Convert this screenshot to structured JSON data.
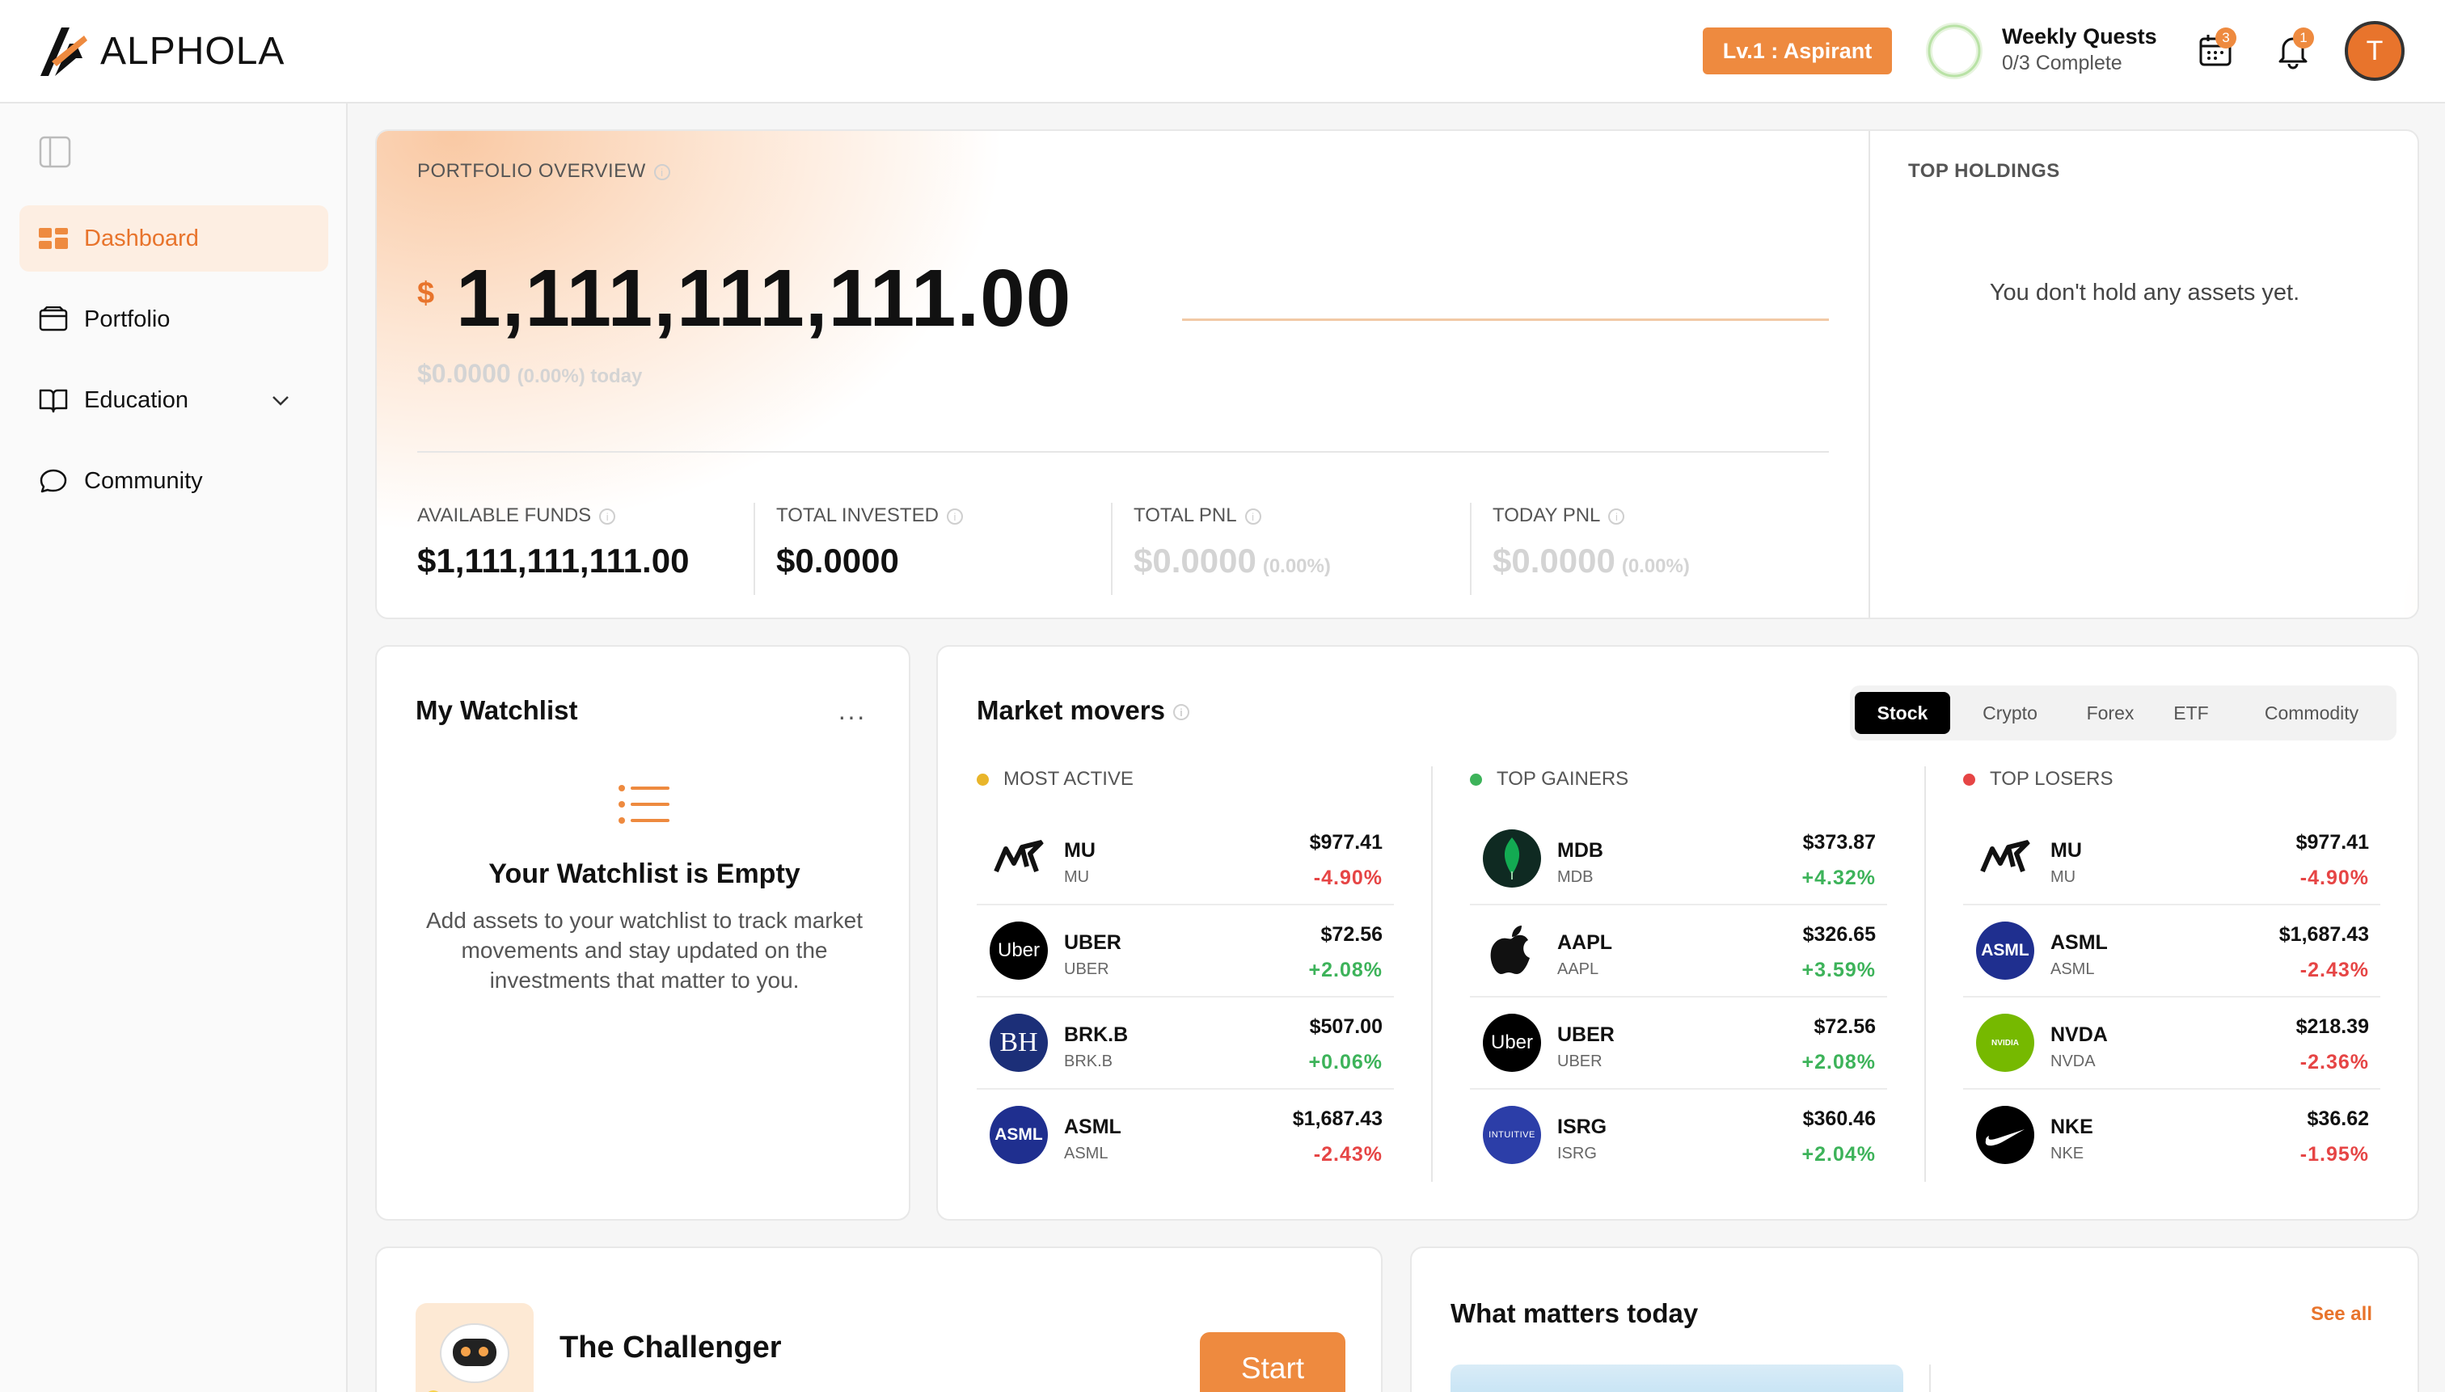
{
  "app": {
    "logo_text": "ALPHOLA"
  },
  "header": {
    "level_badge": "Lv.1 : Aspirant",
    "quests_title": "Weekly Quests",
    "quests_status": "0/3 Complete",
    "quests_progress": 0,
    "calendar_count": "3",
    "notification_count": "1",
    "avatar_initial": "T",
    "accent_color": "#ee8a3f"
  },
  "sidebar": {
    "items": [
      {
        "label": "Dashboard",
        "icon": "dashboard-icon",
        "active": true
      },
      {
        "label": "Portfolio",
        "icon": "wallet-icon"
      },
      {
        "label": "Education",
        "icon": "book-icon"
      },
      {
        "label": "Community",
        "icon": "chat-bubble-icon"
      }
    ]
  },
  "portfolio": {
    "label": "PORTFOLIO OVERVIEW",
    "currency_symbol": "$",
    "total_value": "1,111,111,111.00",
    "today_change": "$0.0000",
    "today_change_pct": "(0.00%) today",
    "stats": [
      {
        "label": "AVAILABLE FUNDS",
        "value": "$1,111,111,111.00"
      },
      {
        "label": "TOTAL INVESTED",
        "value": "$0.0000"
      },
      {
        "label": "TOTAL PNL",
        "value": "$0.0000",
        "pct": "(0.00%)"
      },
      {
        "label": "TODAY PNL",
        "value": "$0.0000",
        "pct": "(0.00%)"
      }
    ]
  },
  "top_holdings": {
    "label": "TOP HOLDINGS",
    "empty_text": "You don't hold any assets yet."
  },
  "watchlist": {
    "title": "My Watchlist",
    "menu": "···",
    "empty_title": "Your Watchlist is Empty",
    "empty_desc": "Add assets to your watchlist to track market movements and stay updated on the investments that matter to you."
  },
  "movers": {
    "title": "Market movers",
    "tabs": [
      "Stock",
      "Crypto",
      "Forex",
      "ETF",
      "Commodity"
    ],
    "active_tab": "Stock",
    "columns": [
      {
        "title": "MOST ACTIVE",
        "dot_color": "#e9b52a",
        "rows": [
          {
            "ticker": "MU",
            "sub": "MU",
            "price": "$977.41",
            "change": "-4.90%",
            "dir": "down"
          },
          {
            "ticker": "UBER",
            "sub": "UBER",
            "price": "$72.56",
            "change": "+2.08%",
            "dir": "up"
          },
          {
            "ticker": "BRK.B",
            "sub": "BRK.B",
            "price": "$507.00",
            "change": "+0.06%",
            "dir": "up"
          },
          {
            "ticker": "ASML",
            "sub": "ASML",
            "price": "$1,687.43",
            "change": "-2.43%",
            "dir": "down"
          }
        ]
      },
      {
        "title": "TOP GAINERS",
        "dot_color": "#3db35a",
        "rows": [
          {
            "ticker": "MDB",
            "sub": "MDB",
            "price": "$373.87",
            "change": "+4.32%",
            "dir": "up"
          },
          {
            "ticker": "AAPL",
            "sub": "AAPL",
            "price": "$326.65",
            "change": "+3.59%",
            "dir": "up"
          },
          {
            "ticker": "UBER",
            "sub": "UBER",
            "price": "$72.56",
            "change": "+2.08%",
            "dir": "up"
          },
          {
            "ticker": "ISRG",
            "sub": "ISRG",
            "price": "$360.46",
            "change": "+2.04%",
            "dir": "up"
          }
        ]
      },
      {
        "title": "TOP LOSERS",
        "dot_color": "#e64545",
        "rows": [
          {
            "ticker": "MU",
            "sub": "MU",
            "price": "$977.41",
            "change": "-4.90%",
            "dir": "down"
          },
          {
            "ticker": "ASML",
            "sub": "ASML",
            "price": "$1,687.43",
            "change": "-2.43%",
            "dir": "down"
          },
          {
            "ticker": "NVDA",
            "sub": "NVDA",
            "price": "$218.39",
            "change": "-2.36%",
            "dir": "down"
          },
          {
            "ticker": "NKE",
            "sub": "NKE",
            "price": "$36.62",
            "change": "-1.95%",
            "dir": "down"
          }
        ]
      }
    ]
  },
  "logos": {
    "uber": "Uber",
    "brk": "BH",
    "asml": "ASML",
    "isrg": "INTUITIVE",
    "nvda": "NVIDIA"
  },
  "challenger": {
    "title": "The Challenger",
    "button": "Start"
  },
  "news": {
    "title": "What matters today",
    "see_all": "See all"
  }
}
